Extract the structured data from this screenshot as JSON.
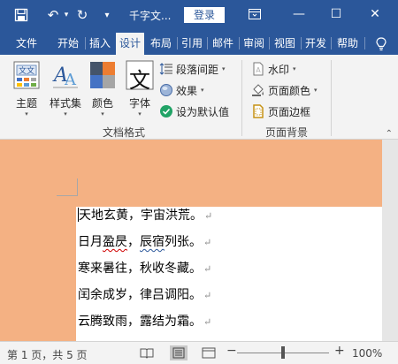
{
  "titlebar": {
    "doc_title": "千字文...",
    "login_label": "登录",
    "save_glyph": "🖫",
    "undo_glyph": "↶",
    "redo_glyph": "↻",
    "customize_glyph": "▾",
    "ribbon_display_glyph": "⊡",
    "minimize_glyph": "—",
    "maximize_glyph": "☐",
    "close_glyph": "✕"
  },
  "tabs": [
    {
      "label": "文件"
    },
    {
      "label": "开始"
    },
    {
      "label": "插入"
    },
    {
      "label": "设计"
    },
    {
      "label": "布局"
    },
    {
      "label": "引用"
    },
    {
      "label": "邮件"
    },
    {
      "label": "审阅"
    },
    {
      "label": "视图"
    },
    {
      "label": "开发"
    },
    {
      "label": "帮助"
    }
  ],
  "tell_me_icon": "lightbulb-icon",
  "ribbon": {
    "document_format": {
      "group_label": "文档格式",
      "theme_label": "主题",
      "style_set_label": "样式集",
      "colors_label": "颜色",
      "fonts_label": "字体",
      "font_icon_glyph": "文",
      "paragraph_spacing_label": "段落间距",
      "effects_label": "效果",
      "set_default_label": "设为默认值"
    },
    "page_background": {
      "group_label": "页面背景",
      "watermark_label": "水印",
      "page_color_label": "页面颜色",
      "page_borders_label": "页面边框"
    }
  },
  "document": {
    "lines": [
      "天地玄黄，宇宙洪荒。",
      "日月盈昃，辰宿列张。",
      "寒来暑往，秋收冬藏。",
      "闰余成岁，律吕调阳。",
      "云腾致雨，露结为霜。"
    ],
    "line2_parts": [
      "日月",
      "盈昃",
      "，",
      "辰宿",
      "列张。"
    ],
    "paragraph_mark": "↵",
    "page_color": "#f4b183"
  },
  "statusbar": {
    "page_info": "第 1 页，共 5 页",
    "zoom_minus": "−",
    "zoom_plus": "+",
    "zoom": "100%"
  },
  "colors": {
    "accent": "#2b579a",
    "ribbon_bg": "#f3f3f3",
    "page_color": "#f4b183"
  }
}
